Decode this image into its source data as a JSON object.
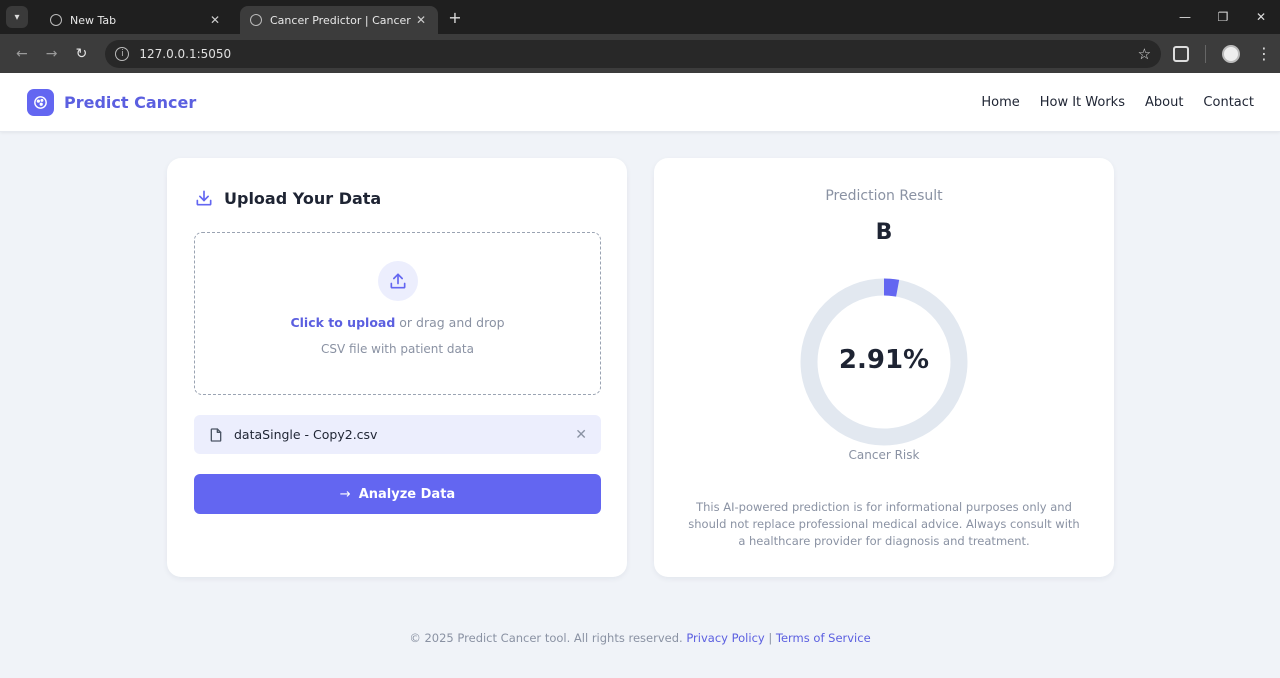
{
  "browser": {
    "tabs": [
      {
        "title": "New Tab"
      },
      {
        "title": "Cancer Predictor | Cancer Predic"
      }
    ],
    "url": "127.0.0.1:5050"
  },
  "header": {
    "logo_text": "Predict Cancer",
    "nav": [
      "Home",
      "How It Works",
      "About",
      "Contact"
    ]
  },
  "upload": {
    "title": "Upload Your Data",
    "click_text": "Click to upload",
    "drag_text": " or drag and drop",
    "hint": "CSV file with patient data",
    "file_name": "dataSingle - Copy2.csv",
    "button_label": "Analyze Data"
  },
  "result": {
    "title": "Prediction Result",
    "class_label": "B",
    "risk_value": "2.91%",
    "risk_fraction": 0.0291,
    "risk_label": "Cancer Risk",
    "disclaimer": "This AI-powered prediction is for informational purposes only and should not replace professional medical advice. Always consult with a healthcare provider for diagnosis and treatment."
  },
  "footer": {
    "copyright": "© 2025 Predict Cancer tool. All rights reserved. ",
    "privacy": "Privacy Policy",
    "separator": " | ",
    "terms": "Terms of Service"
  },
  "colors": {
    "accent": "#6366f1",
    "gauge_track": "#e2e8f0"
  }
}
